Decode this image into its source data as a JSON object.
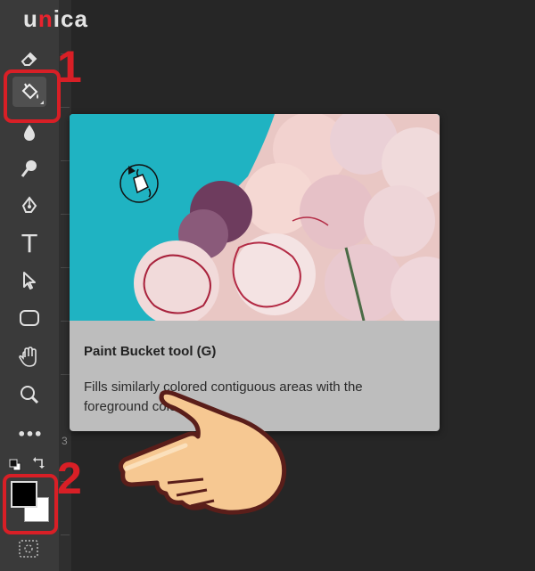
{
  "logo": {
    "prefix": "u",
    "accent": "n",
    "suffix": "ica"
  },
  "tools": [
    {
      "name": "eraser-tool",
      "icon": "eraser-icon"
    },
    {
      "name": "paint-bucket-tool",
      "icon": "paint-bucket-icon"
    },
    {
      "name": "blur-tool",
      "icon": "blur-drop-icon"
    },
    {
      "name": "dodge-tool",
      "icon": "dodge-icon"
    },
    {
      "name": "pen-tool",
      "icon": "pen-icon"
    },
    {
      "name": "type-tool",
      "icon": "type-icon"
    },
    {
      "name": "path-selection-tool",
      "icon": "path-selection-icon"
    },
    {
      "name": "rectangle-tool",
      "icon": "rounded-rectangle-icon"
    },
    {
      "name": "hand-tool",
      "icon": "hand-icon"
    },
    {
      "name": "zoom-tool",
      "icon": "zoom-icon"
    },
    {
      "name": "more-tools",
      "icon": "more-icon"
    }
  ],
  "type_tool_glyph": "T",
  "more_tools_glyph": "•••",
  "annotations": {
    "step1": "1",
    "step2": "2",
    "ruler_number": "3"
  },
  "highlight_color": "#d81f26",
  "colors": {
    "foreground": "#000000",
    "background": "#ffffff"
  },
  "tooltip": {
    "title": "Paint Bucket tool (G)",
    "description": "Fills similarly colored contiguous areas with the foreground color",
    "image_background": "#1fb3c2"
  }
}
